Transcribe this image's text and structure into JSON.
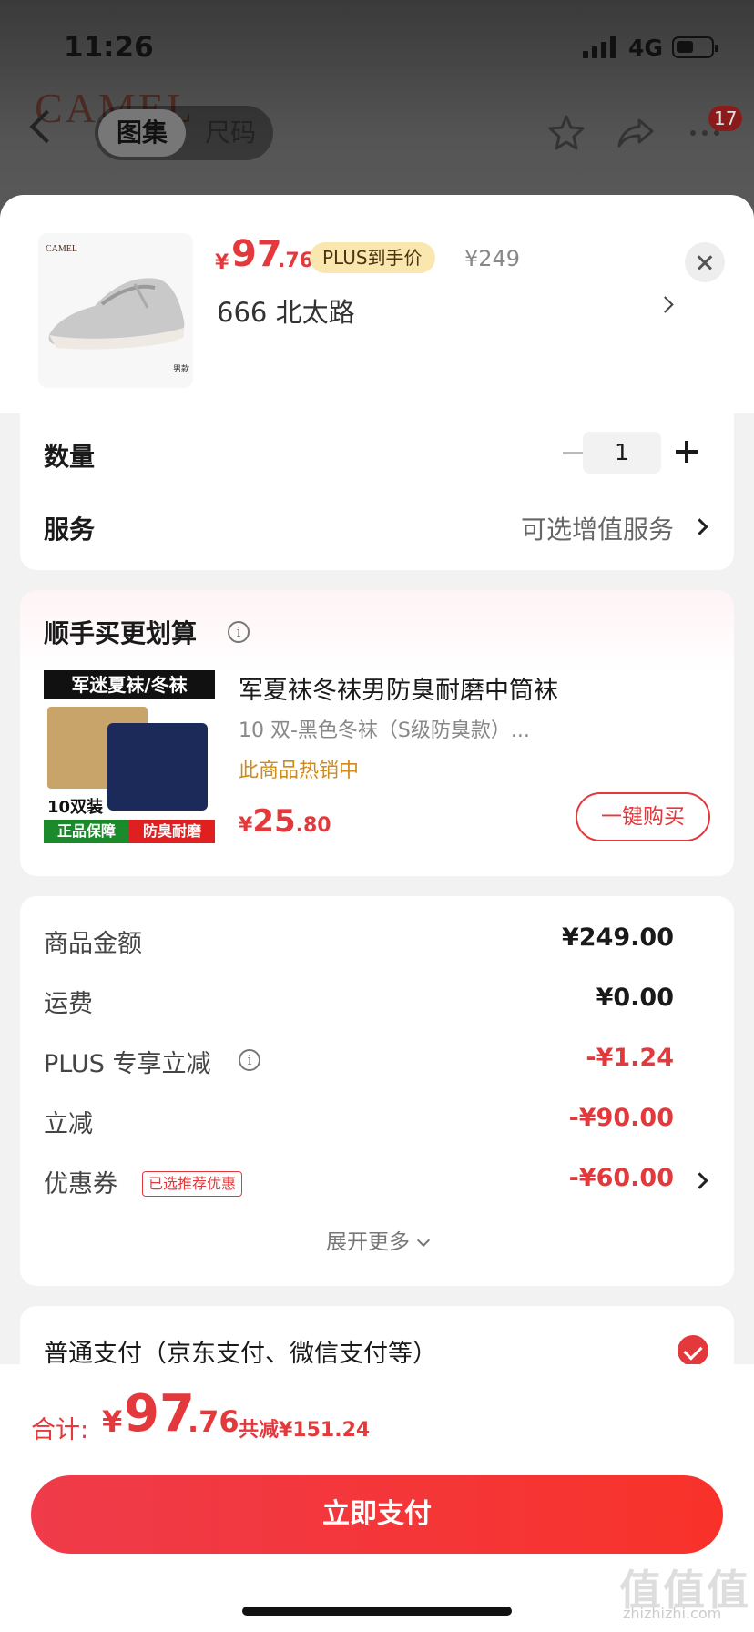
{
  "status_bar": {
    "time": "11:26",
    "network": "4G"
  },
  "nav": {
    "brand": "CAMEL",
    "tabs": [
      {
        "label": "图集",
        "active": true
      },
      {
        "label": "尺码",
        "active": false
      }
    ],
    "cart_badge": "17"
  },
  "product": {
    "thumb_brand": "CAMEL",
    "thumb_tag": "男款",
    "price_currency": "¥",
    "price_int": "97",
    "price_dec": ".76",
    "plus_tag": "PLUS到手价",
    "original_price": "¥249",
    "address": "666  北太路"
  },
  "options": {
    "quantity_label": "数量",
    "quantity_value": "1",
    "service_label": "服务",
    "service_value": "可选增值服务"
  },
  "upsell": {
    "title": "顺手买更划算",
    "image_banner": "军迷夏袜/冬袜",
    "image_count": "10双装",
    "image_tag_green": "正品保障",
    "image_tag_red": "防臭耐磨",
    "name": "军夏袜冬袜男防臭耐磨中筒袜",
    "spec": "10 双-黑色冬袜（S级防臭款）...",
    "hot": "此商品热销中",
    "price_currency": "¥",
    "price_int": "25",
    "price_dec": ".80",
    "buy_label": "一键购买"
  },
  "fees": {
    "rows": [
      {
        "label": "商品金额",
        "value": "¥249.00",
        "color": "#1a1a1a"
      },
      {
        "label": "运费",
        "value": "¥0.00",
        "color": "#1a1a1a"
      },
      {
        "label": "PLUS 专享立减",
        "value": "-¥1.24",
        "color": "#e4393c"
      },
      {
        "label": "立减",
        "value": "-¥90.00",
        "color": "#e4393c"
      },
      {
        "label": "优惠券",
        "value": "-¥60.00",
        "color": "#e4393c"
      }
    ],
    "coupon_tag": "已选推荐优惠",
    "expand_label": "展开更多"
  },
  "payment": {
    "method": "普通支付（京东支付、微信支付等）",
    "selected": true
  },
  "footer": {
    "total_label": "合计:",
    "total_currency": "¥",
    "total_int": "97",
    "total_dec": ".76",
    "total_saved": "共减¥151.24",
    "pay_button": "立即支付"
  },
  "watermark": {
    "text": "值值值",
    "sub": "zhizhizhi.com"
  },
  "colors": {
    "accent": "#e4393c",
    "plus_tag_bg": "#fae7b0",
    "hot": "#d08a1c"
  }
}
